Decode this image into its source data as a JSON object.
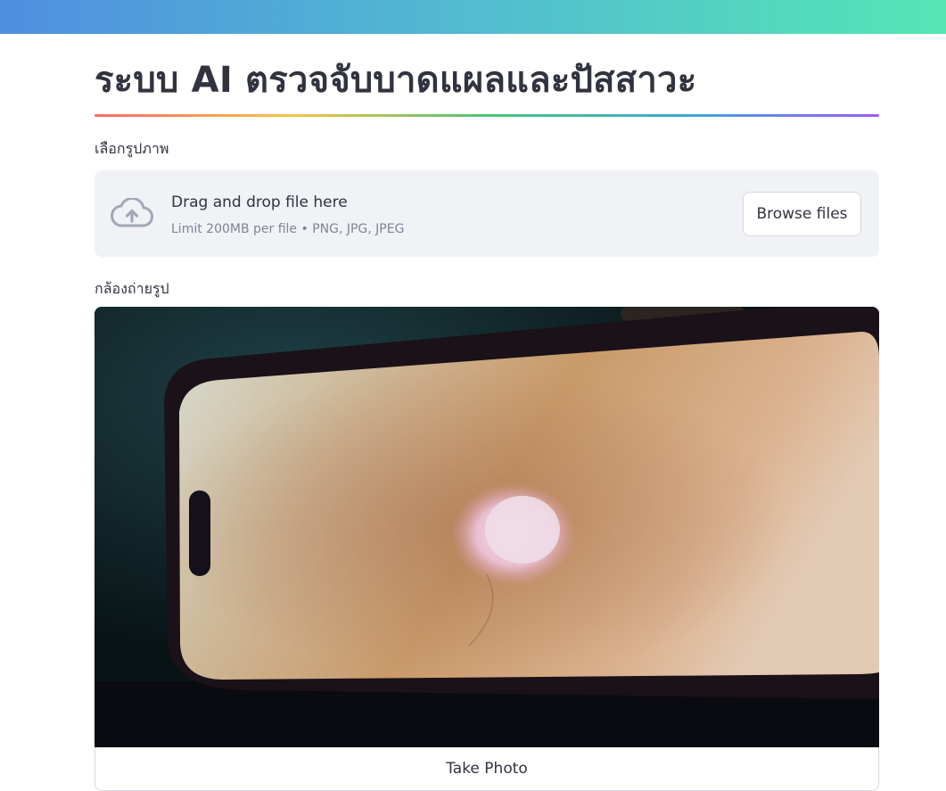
{
  "header": {
    "title": "ระบบ AI ตรวจจับบาดแผลและปัสสาวะ"
  },
  "uploader": {
    "label": "เลือกรูปภาพ",
    "dropzone_title": "Drag and drop file here",
    "dropzone_hint": "Limit 200MB per file • PNG, JPG, JPEG",
    "browse_label": "Browse files",
    "icon": "cloud-upload-icon"
  },
  "camera": {
    "label": "กล้องถ่ายรูป",
    "take_photo_label": "Take Photo"
  },
  "colors": {
    "accent_gradient_start": "#4f8fe0",
    "accent_gradient_end": "#55e6b4",
    "text": "#31333f",
    "muted": "#808495",
    "dropzone_bg": "#f0f2f6"
  }
}
